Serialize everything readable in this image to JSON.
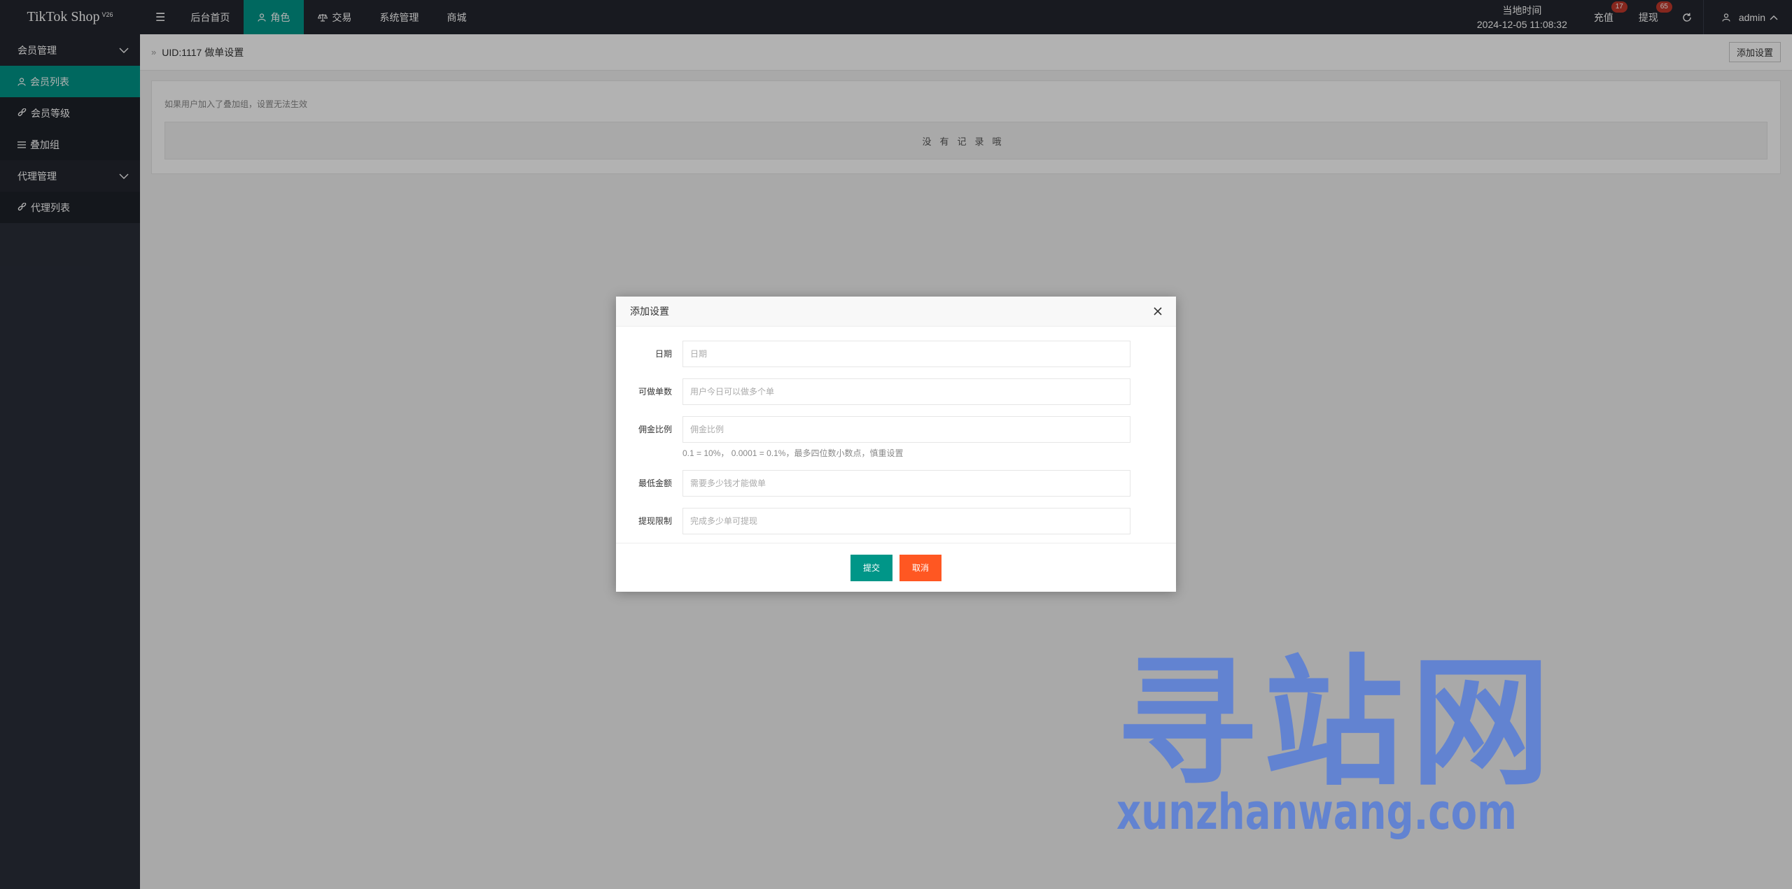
{
  "app": {
    "name": "TikTok Shop",
    "version": "V26"
  },
  "topnav": {
    "menu_toggle": "☰",
    "items": [
      {
        "label": "后台首页",
        "icon": ""
      },
      {
        "label": "角色",
        "icon": "user-icon"
      },
      {
        "label": "交易",
        "icon": "scale-icon"
      },
      {
        "label": "系统管理",
        "icon": ""
      },
      {
        "label": "商城",
        "icon": ""
      }
    ],
    "active_index": 1
  },
  "header_right": {
    "clock_label": "当地时间",
    "clock_value": "2024-12-05 11:08:32",
    "recharge": {
      "label": "充值",
      "count": "17"
    },
    "withdraw": {
      "label": "提现",
      "count": "65"
    },
    "user": "admin"
  },
  "sidebar": {
    "groups": [
      {
        "label": "会员管理",
        "items": [
          {
            "label": "会员列表",
            "icon": "user-icon"
          },
          {
            "label": "会员等级",
            "icon": "link-icon"
          },
          {
            "label": "叠加组",
            "icon": "list-icon"
          }
        ]
      },
      {
        "label": "代理管理",
        "items": [
          {
            "label": "代理列表",
            "icon": "link-icon"
          }
        ]
      }
    ],
    "active_item": "会员列表"
  },
  "page": {
    "breadcrumb_arrows": "»",
    "title": "UID:1117 做单设置",
    "add_button": "添加设置",
    "notice": "如果用户加入了叠加组，设置无法生效",
    "empty_text": "没有记录哦"
  },
  "modal": {
    "title": "添加设置",
    "fields": {
      "date": {
        "label": "日期",
        "placeholder": "日期",
        "value": ""
      },
      "orders": {
        "label": "可做单数",
        "placeholder": "用户今日可以做多个单",
        "value": ""
      },
      "commission": {
        "label": "佣金比例",
        "placeholder": "佣金比例",
        "value": "",
        "hint": "0.1 = 10%， 0.0001 = 0.1%，最多四位数小数点，慎重设置"
      },
      "min_amount": {
        "label": "最低金额",
        "placeholder": "需要多少钱才能做单",
        "value": ""
      },
      "withdraw_limit": {
        "label": "提现限制",
        "placeholder": "完成多少单可提现",
        "value": ""
      }
    },
    "submit": "提交",
    "cancel": "取消"
  },
  "watermark": {
    "cn": "寻站网",
    "en": "xunzhanwang.com",
    "color": "#5b7fd6"
  },
  "colors": {
    "accent": "#009688",
    "danger": "#ff5722",
    "topbar": "#23262e",
    "badge": "#c0392b"
  }
}
